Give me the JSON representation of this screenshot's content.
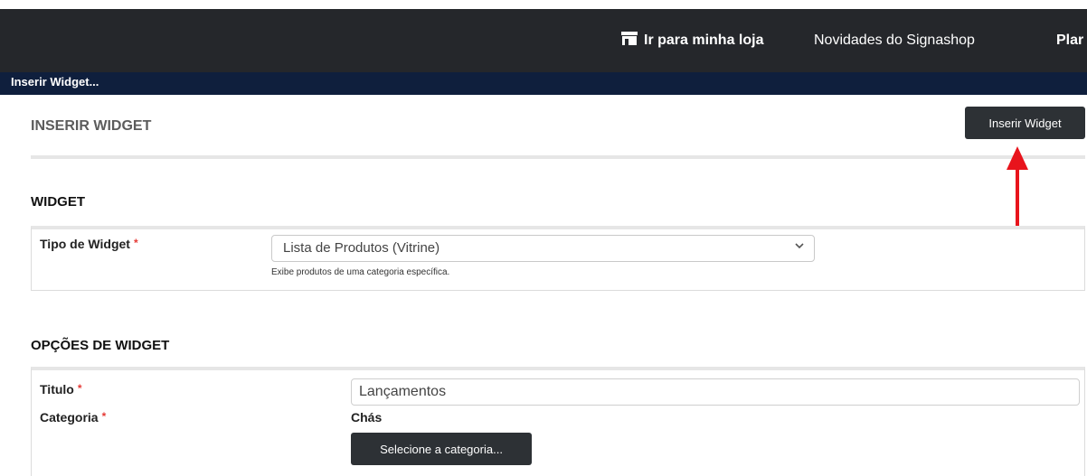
{
  "topbar": {
    "store_icon": "store-icon",
    "store_link": "Ir para minha loja",
    "news_link": "Novidades do Signashop",
    "plan_link": "Plar"
  },
  "breadcrumb": "Inserir Widget...",
  "page": {
    "title": "INSERIR WIDGET",
    "insert_button": "Inserir Widget",
    "annotation_arrow_color": "#e8141c"
  },
  "widget_section": {
    "title": "WIDGET",
    "type_label": "Tipo de Widget",
    "required_mark": "*",
    "type_value": "Lista de Produtos (Vitrine)",
    "type_help": "Exibe produtos de uma categoria específica."
  },
  "options_section": {
    "title": "OPÇÕES DE WIDGET",
    "title_label": "Titulo",
    "title_value": "Lançamentos",
    "category_label": "Categoria",
    "category_value": "Chás",
    "category_button": "Selecione a categoria..."
  }
}
